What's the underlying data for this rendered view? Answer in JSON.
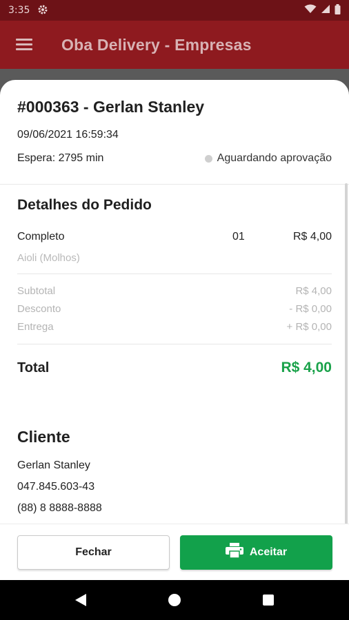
{
  "status_bar": {
    "time": "3:35",
    "icons": [
      "gear-icon",
      "wifi-icon",
      "signal-icon",
      "battery-icon"
    ]
  },
  "app_bar": {
    "title": "Oba Delivery - Empresas",
    "menu_icon": "hamburger-menu-icon",
    "color": "#8e1a1f"
  },
  "order": {
    "title": "#000363 - Gerlan Stanley",
    "datetime": "09/06/2021 16:59:34",
    "wait": "Espera: 2795 min",
    "status": "Aguardando aprovação"
  },
  "details": {
    "title": "Detalhes do Pedido",
    "items": [
      {
        "name": "Completo",
        "qty": "01",
        "price": "R$ 4,00",
        "sub": "Aioli (Molhos)"
      }
    ],
    "subtotal_label": "Subtotal",
    "subtotal_value": "R$ 4,00",
    "discount_label": "Desconto",
    "discount_value": "- R$ 0,00",
    "delivery_label": "Entrega",
    "delivery_value": "+ R$ 0,00",
    "total_label": "Total",
    "total_value": "R$ 4,00",
    "total_color": "#1aa24a"
  },
  "client": {
    "title": "Cliente",
    "name": "Gerlan Stanley",
    "document": "047.845.603-43",
    "phone": "(88) 8 8888-8888"
  },
  "footer": {
    "close_label": "Fechar",
    "accept_label": "Aceitar",
    "accept_icon": "printer-icon",
    "accept_color": "#12a14b"
  },
  "nav": {
    "icons": [
      "back-icon",
      "home-icon",
      "recents-icon"
    ]
  }
}
